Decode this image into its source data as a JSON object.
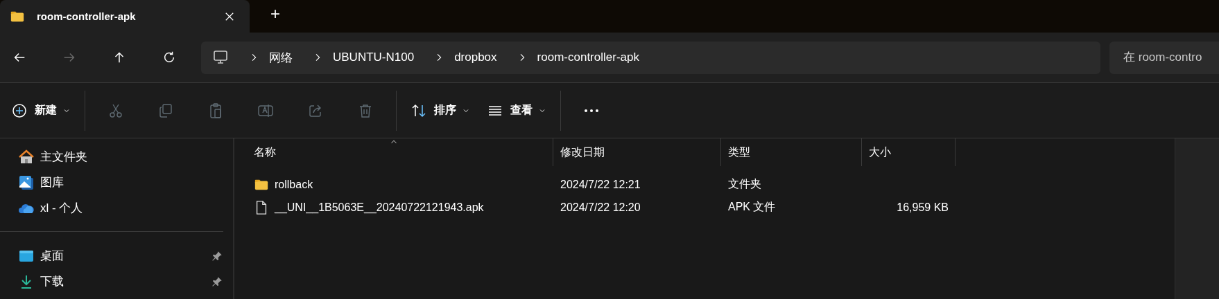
{
  "tab": {
    "title": "room-controller-apk",
    "new_tab": "+"
  },
  "nav_buttons": [
    {
      "kind": "back",
      "disabled": false
    },
    {
      "kind": "forward",
      "disabled": true
    },
    {
      "kind": "up",
      "disabled": false
    },
    {
      "kind": "refresh",
      "disabled": false
    }
  ],
  "breadcrumbs": [
    "网络",
    "UBUNTU-N100",
    "dropbox",
    "room-controller-apk"
  ],
  "search": {
    "placeholder": "在 room-contro"
  },
  "toolbar": [
    [
      {
        "kind": "new",
        "label": "新建",
        "dropdown": true,
        "disabled": false
      }
    ],
    [
      {
        "kind": "cut",
        "disabled": true
      },
      {
        "kind": "copy",
        "disabled": true
      },
      {
        "kind": "paste",
        "disabled": true
      },
      {
        "kind": "rename",
        "disabled": true
      },
      {
        "kind": "share",
        "disabled": true
      },
      {
        "kind": "delete",
        "disabled": true
      }
    ],
    [
      {
        "kind": "sort",
        "label": "排序",
        "dropdown": true,
        "disabled": false
      },
      {
        "kind": "view",
        "label": "查看",
        "dropdown": true,
        "disabled": false
      }
    ],
    [
      {
        "kind": "more",
        "disabled": false
      }
    ]
  ],
  "sidebar": [
    [
      {
        "kind": "home",
        "label": "主文件夹",
        "pinned": false
      },
      {
        "kind": "gallery",
        "label": "图库",
        "pinned": false
      },
      {
        "kind": "cloud",
        "label": "xl - 个人",
        "pinned": false
      }
    ],
    [
      {
        "kind": "desktop",
        "label": "桌面",
        "pinned": true
      },
      {
        "kind": "download",
        "label": "下载",
        "pinned": true
      }
    ]
  ],
  "columns": [
    {
      "label": "名称",
      "sorted": true
    },
    {
      "label": "修改日期",
      "sorted": false
    },
    {
      "label": "类型",
      "sorted": false
    },
    {
      "label": "大小",
      "sorted": false
    }
  ],
  "files": [
    {
      "kind": "folder",
      "name": "rollback",
      "modified": "2024/7/22 12:21",
      "type": "文件夹"
    },
    {
      "kind": "file",
      "name": "__UNI__1B5063E__20240722121943.apk",
      "modified": "2024/7/22 12:20",
      "type": "APK 文件",
      "size": "16,959 KB"
    }
  ]
}
